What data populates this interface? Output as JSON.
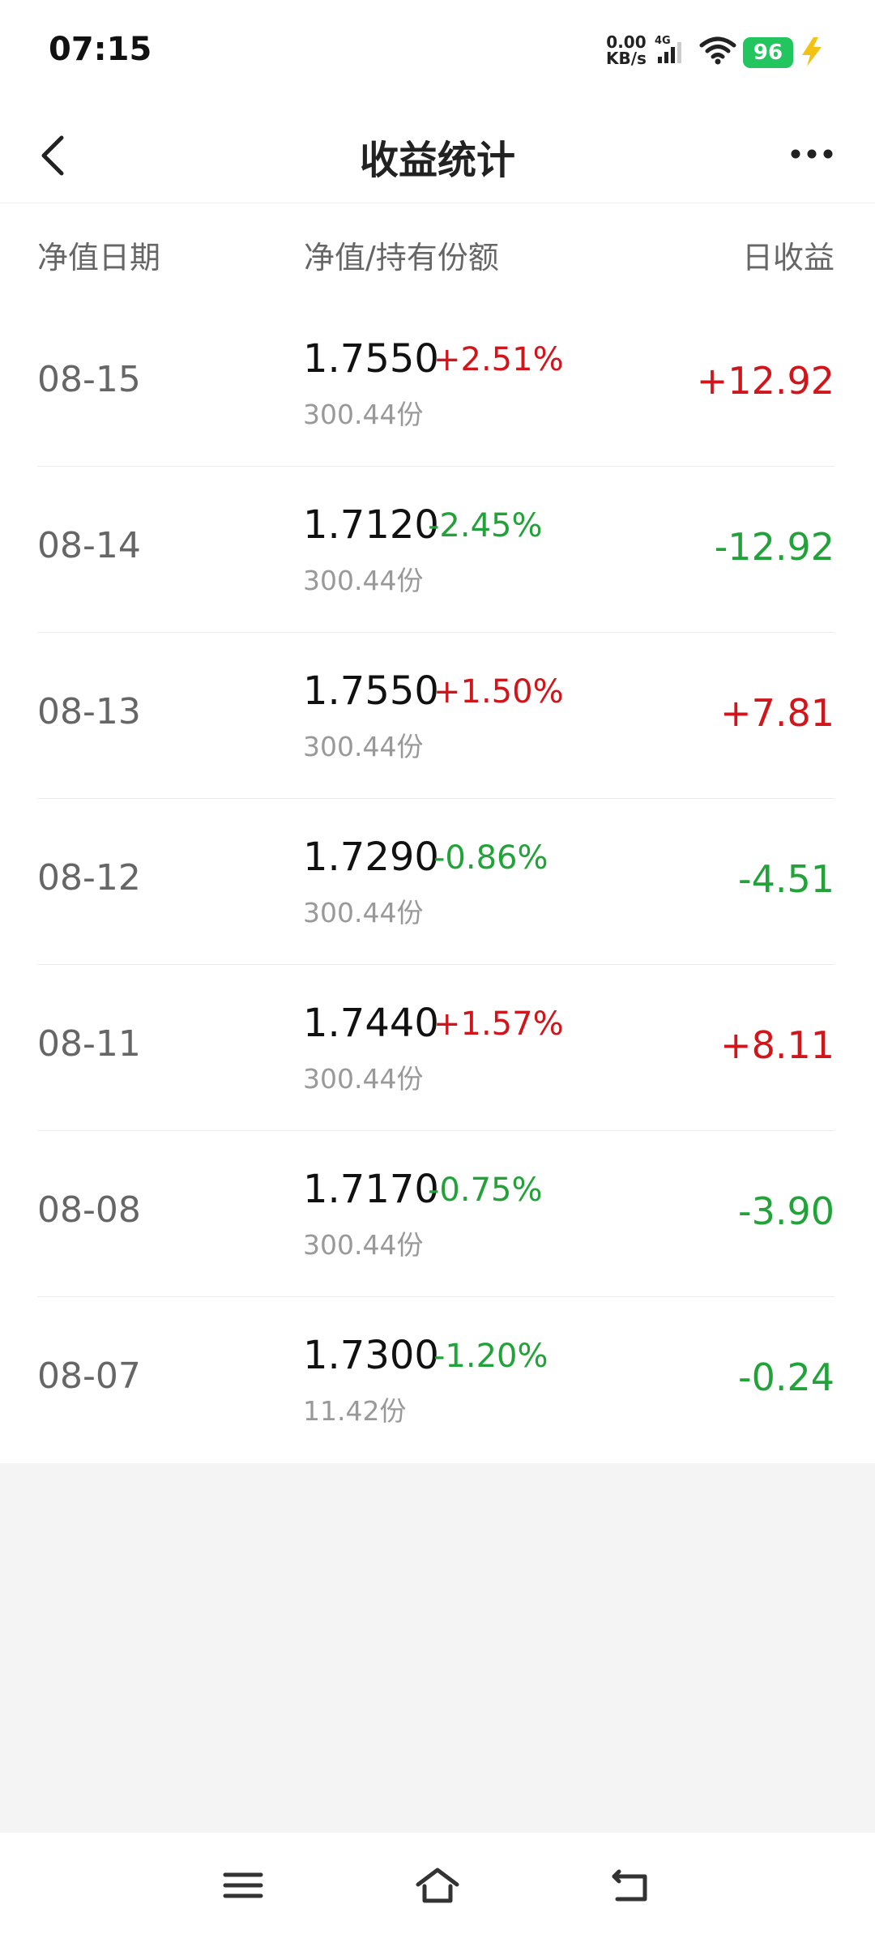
{
  "status": {
    "time": "07:15",
    "net_speed": "0.00",
    "net_unit": "KB/s",
    "network": "4G",
    "battery": "96"
  },
  "nav": {
    "title": "收益统计"
  },
  "header": {
    "col1": "净值日期",
    "col2": "净值/持有份额",
    "col3": "日收益"
  },
  "rows": [
    {
      "date": "08-15",
      "nav": "1.7550",
      "pct": "+2.51%",
      "shares": "300.44份",
      "gain": "+12.92",
      "dir": "up"
    },
    {
      "date": "08-14",
      "nav": "1.7120",
      "pct": "-2.45%",
      "shares": "300.44份",
      "gain": "-12.92",
      "dir": "down"
    },
    {
      "date": "08-13",
      "nav": "1.7550",
      "pct": "+1.50%",
      "shares": "300.44份",
      "gain": "+7.81",
      "dir": "up"
    },
    {
      "date": "08-12",
      "nav": "1.7290",
      "pct": "-0.86%",
      "shares": "300.44份",
      "gain": "-4.51",
      "dir": "down"
    },
    {
      "date": "08-11",
      "nav": "1.7440",
      "pct": "+1.57%",
      "shares": "300.44份",
      "gain": "+8.11",
      "dir": "up"
    },
    {
      "date": "08-08",
      "nav": "1.7170",
      "pct": "-0.75%",
      "shares": "300.44份",
      "gain": "-3.90",
      "dir": "down"
    },
    {
      "date": "08-07",
      "nav": "1.7300",
      "pct": "-1.20%",
      "shares": "11.42份",
      "gain": "-0.24",
      "dir": "down"
    }
  ],
  "colors": {
    "up": "#d0161b",
    "down": "#22a33a",
    "battery": "#22c55e"
  }
}
